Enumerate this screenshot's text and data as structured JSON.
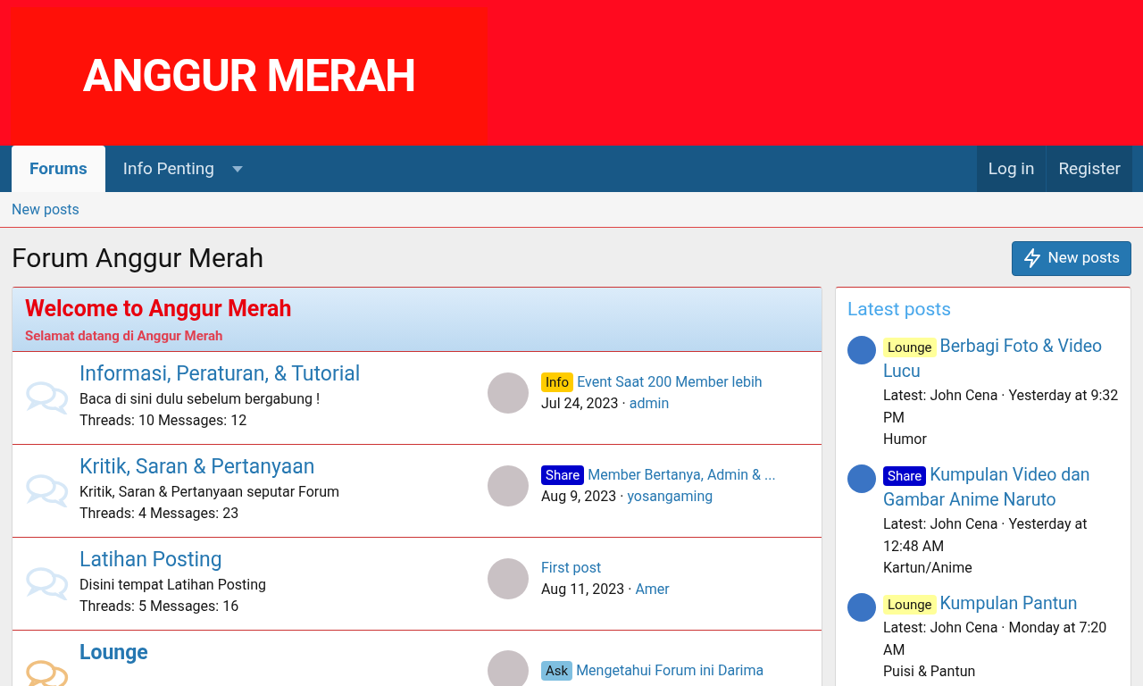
{
  "logo": {
    "text": "ANGGUR MERAH"
  },
  "nav": {
    "tabs": [
      {
        "label": "Forums",
        "selected": true,
        "dropdown": false
      },
      {
        "label": "Info Penting",
        "selected": false,
        "dropdown": true
      }
    ],
    "account": [
      "Log in",
      "Register"
    ]
  },
  "subnav": {
    "links": [
      "New posts"
    ]
  },
  "page": {
    "title": "Forum Anggur Merah",
    "button": "New posts"
  },
  "category": {
    "title": "Welcome to Anggur Merah",
    "subtitle": "Selamat datang di Anggur Merah",
    "forums": [
      {
        "title": "Informasi, Peraturan, & Tutorial",
        "description": "Baca di sini dulu sebelum bergabung !",
        "stats": "Threads: 10 Messages: 12",
        "unread": false,
        "latest": {
          "prefix": "Info",
          "color": "#ffcc00",
          "thread": "Event Saat 200 Member lebih",
          "date": "Jul 24, 2023",
          "separator": "·",
          "user": "admin"
        }
      },
      {
        "title": "Kritik, Saran & Pertanyaan",
        "description": "Kritik, Saran & Pertanyaan seputar Forum",
        "stats": "Threads: 4 Messages: 23",
        "unread": false,
        "latest": {
          "prefix": "Share",
          "color": "#0000cc",
          "thread": "Member Bertanya, Admin & ...",
          "date": "Aug 9, 2023",
          "separator": "·",
          "user": "yosangaming"
        }
      },
      {
        "title": "Latihan Posting",
        "description": "Disini tempat Latihan Posting",
        "stats": "Threads: 5 Messages: 16",
        "unread": false,
        "latest": {
          "thread": "First post",
          "date": "Aug 11, 2023",
          "separator": "·",
          "user": "Amer"
        }
      },
      {
        "title": "Lounge",
        "unread": true,
        "latest": {
          "prefix": "Ask",
          "color": "#7fbfe0",
          "thread": "Mengetahui Forum ini Darima"
        }
      }
    ]
  },
  "latest_posts": {
    "title": "Latest posts",
    "items": [
      {
        "prefix": "Lounge",
        "color": "#ffff99",
        "thread": "Berbagi Foto & Video Lucu",
        "meta": "Latest: John Cena · Yesterday at 9:32 PM",
        "forum": "Humor"
      },
      {
        "prefix": "Share",
        "color": "#0000cc",
        "thread": "Kumpulan Video dan Gambar Anime Naruto",
        "meta": "Latest: John Cena · Yesterday at 12:48 AM",
        "forum": "Kartun/Anime"
      },
      {
        "prefix": "Lounge",
        "color": "#ffff99",
        "thread": "Kumpulan Pantun",
        "meta": "Latest: John Cena · Monday at 7:20 AM",
        "forum": "Puisi & Pantun"
      }
    ]
  }
}
